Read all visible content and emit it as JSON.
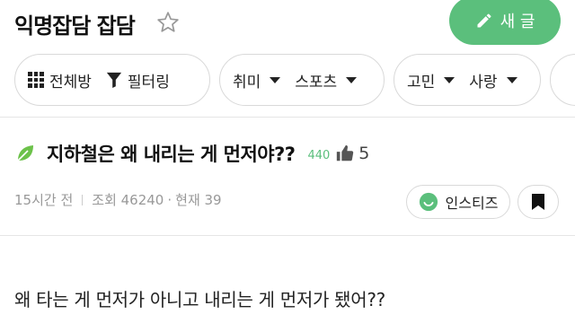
{
  "header": {
    "board_title": "익명잡담 잡담",
    "write_label": "새 글"
  },
  "filters": {
    "all_rooms": "전체방",
    "filtering": "필터링",
    "group_a": [
      "취미",
      "스포츠"
    ],
    "group_b": [
      "고민",
      "사랑"
    ]
  },
  "post": {
    "title": "지하철은 왜 내리는 게 먼저야??",
    "badge_count": "440",
    "like_count": "5",
    "time_ago": "15시간 전",
    "views_label": "조회 46240",
    "current_label": "현재 39",
    "source_label": "인스티즈",
    "body": "왜 타는 게 먼저가 아니고 내리는 게 먼저가 됐어??"
  },
  "colors": {
    "accent_green": "#5bbf7c"
  }
}
